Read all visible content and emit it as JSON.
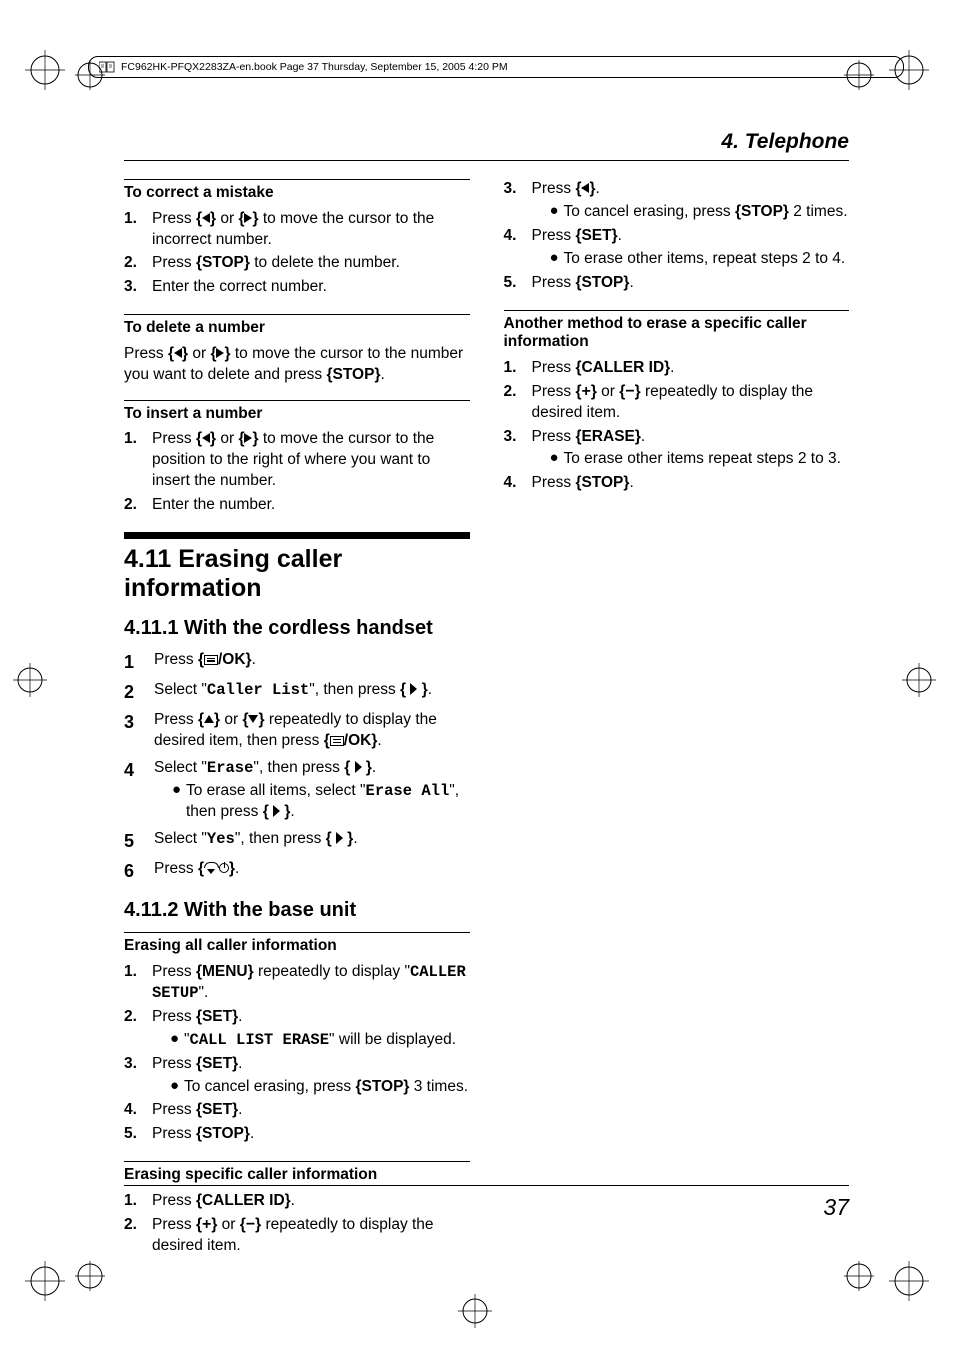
{
  "header_bar": "FC962HK-PFQX2283ZA-en.book  Page 37  Thursday, September 15, 2005  4:20 PM",
  "running_head": "4. Telephone",
  "page_number": "37",
  "left": {
    "correct_mistake": {
      "heading": "To correct a mistake",
      "steps": [
        {
          "n": "1.",
          "pre": "Press ",
          "key1": "{",
          "icon1": "tri-left",
          "key1b": "}",
          "mid": " or ",
          "key2": "{",
          "icon2": "tri-right",
          "key2b": "}",
          "post": " to move the cursor to the incorrect number."
        },
        {
          "n": "2.",
          "pre": "Press ",
          "key": "{STOP}",
          "post": " to delete the number."
        },
        {
          "n": "3.",
          "text": "Enter the correct number."
        }
      ]
    },
    "delete_number": {
      "heading": "To delete a number",
      "text_pre": "Press ",
      "text_mid": " or ",
      "text_post": " to move the cursor to the number you want to delete and press ",
      "text_key": "{STOP}",
      "text_end": "."
    },
    "insert_number": {
      "heading": "To insert a number",
      "steps": [
        {
          "n": "1.",
          "pre": "Press ",
          "mid": " or ",
          "post": " to move the cursor to the position to the right of where you want to insert the number."
        },
        {
          "n": "2.",
          "text": "Enter the number."
        }
      ]
    },
    "section_title": "4.11 Erasing caller information",
    "sub1": {
      "heading": "4.11.1 With the cordless handset",
      "steps": [
        {
          "n": "1",
          "pre": "Press ",
          "keyopen": "{",
          "keyclose": "/OK}",
          "post": "."
        },
        {
          "n": "2",
          "pre": "Select ",
          "q1": "\"",
          "mono": "Caller List",
          "q2": "\"",
          "mid": ", then press ",
          "post": "."
        },
        {
          "n": "3",
          "pre": "Press ",
          "mid": " or ",
          "post": " repeatedly to display the desired item, then press ",
          "keyopen2": "{",
          "keyclose2": "/OK}",
          "end": "."
        },
        {
          "n": "4",
          "pre": "Select ",
          "q1": "\"",
          "mono": "Erase",
          "q2": "\"",
          "mid": ", then press ",
          "post": ".",
          "bullet_pre": "To erase all items, select ",
          "bullet_q1": "\"",
          "bullet_mono": "Erase All",
          "bullet_q2": "\"",
          "bullet_mid": ", then press ",
          "bullet_post": "."
        },
        {
          "n": "5",
          "pre": "Select ",
          "q1": "\"",
          "mono": "Yes",
          "q2": "\"",
          "mid": ", then press ",
          "post": "."
        },
        {
          "n": "6",
          "pre": "Press ",
          "post": "."
        }
      ]
    },
    "sub2": {
      "heading": "4.11.2 With the base unit",
      "erase_all": {
        "heading": "Erasing all caller information",
        "steps": [
          {
            "n": "1.",
            "pre": "Press ",
            "key": "{MENU}",
            "post": " repeatedly to display ",
            "q1": "\"",
            "mono": "CALLER SETUP",
            "q2": "\"",
            "end": "."
          },
          {
            "n": "2.",
            "pre": "Press ",
            "key": "{SET}",
            "post": ".",
            "bullet_q1": "\"",
            "bullet_mono": "CALL LIST ERASE",
            "bullet_q2": "\"",
            "bullet_post": " will be displayed."
          },
          {
            "n": "3.",
            "pre": "Press ",
            "key": "{SET}",
            "post": ".",
            "bullet_pre": "To cancel erasing, press ",
            "bullet_key": "{STOP}",
            "bullet_post": " 3 times."
          },
          {
            "n": "4.",
            "pre": "Press ",
            "key": "{SET}",
            "post": "."
          },
          {
            "n": "5.",
            "pre": "Press ",
            "key": "{STOP}",
            "post": "."
          }
        ]
      },
      "erase_specific": {
        "heading": "Erasing specific caller information",
        "steps": [
          {
            "n": "1.",
            "pre": "Press ",
            "key": "{CALLER ID}",
            "post": "."
          },
          {
            "n": "2.",
            "pre": "Press ",
            "mid": " or ",
            "post": " repeatedly to display the desired item."
          }
        ]
      }
    }
  },
  "right": {
    "cont_steps": [
      {
        "n": "3.",
        "pre": "Press ",
        "post": ".",
        "bullet_pre": "To cancel erasing, press ",
        "bullet_key": "{STOP}",
        "bullet_post": " 2 times."
      },
      {
        "n": "4.",
        "pre": "Press ",
        "key": "{SET}",
        "post": ".",
        "bullet_pre": "To erase other items, repeat steps 2 to 4."
      },
      {
        "n": "5.",
        "pre": "Press ",
        "key": "{STOP}",
        "post": "."
      }
    ],
    "another_method": {
      "heading": "Another method to erase a specific caller information",
      "steps": [
        {
          "n": "1.",
          "pre": "Press ",
          "key": "{CALLER ID}",
          "post": "."
        },
        {
          "n": "2.",
          "pre": "Press ",
          "mid": " or ",
          "post": " repeatedly to display the desired item."
        },
        {
          "n": "3.",
          "pre": "Press ",
          "key": "{ERASE}",
          "post": ".",
          "bullet_pre": "To erase other items repeat steps 2 to 3."
        },
        {
          "n": "4.",
          "pre": "Press ",
          "key": "{STOP}",
          "post": "."
        }
      ]
    }
  }
}
